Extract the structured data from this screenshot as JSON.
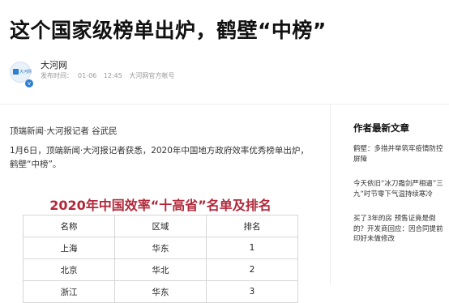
{
  "article": {
    "title": "这个国家级榜单出炉，鹤壁“中榜”",
    "author": {
      "name": "大河网",
      "avatar_text": "大河网",
      "verified_badge": "v",
      "published_label": "发布时间：",
      "date": "01-06",
      "time": "12:45",
      "account_type": "大河网官方帐号"
    },
    "byline": "顶端新闻·大河报记者 谷武民",
    "paragraph": "1月6日，顶端新闻·大河报记者获悉，2020年中国地方政府效率优秀榜单出炉，鹤壁“中榜”。",
    "table": {
      "title": "2020年中国效率“十高省”名单及排名",
      "headers": [
        "名称",
        "区域",
        "排名"
      ],
      "rows": [
        [
          "上海",
          "华东",
          "1"
        ],
        [
          "北京",
          "华北",
          "2"
        ],
        [
          "浙江",
          "华东",
          "3"
        ]
      ]
    }
  },
  "sidebar": {
    "title": "作者最新文章",
    "items": [
      {
        "text": "鹤壁：多措并举筑牢疫情防控屏障"
      },
      {
        "text": "今天依旧“冰刀霜剑严相逼”三九”时节零下气温持续寒冷"
      },
      {
        "text": "买了3年的房 预售证竟是假的？开发商回应：因合同提前印好未做修改"
      }
    ]
  },
  "icons": {
    "avatar": "dahe-logo-icon",
    "verified": "verified-badge-icon"
  },
  "colors": {
    "table_title": "#b2283a",
    "accent": "#2f7fd0"
  }
}
